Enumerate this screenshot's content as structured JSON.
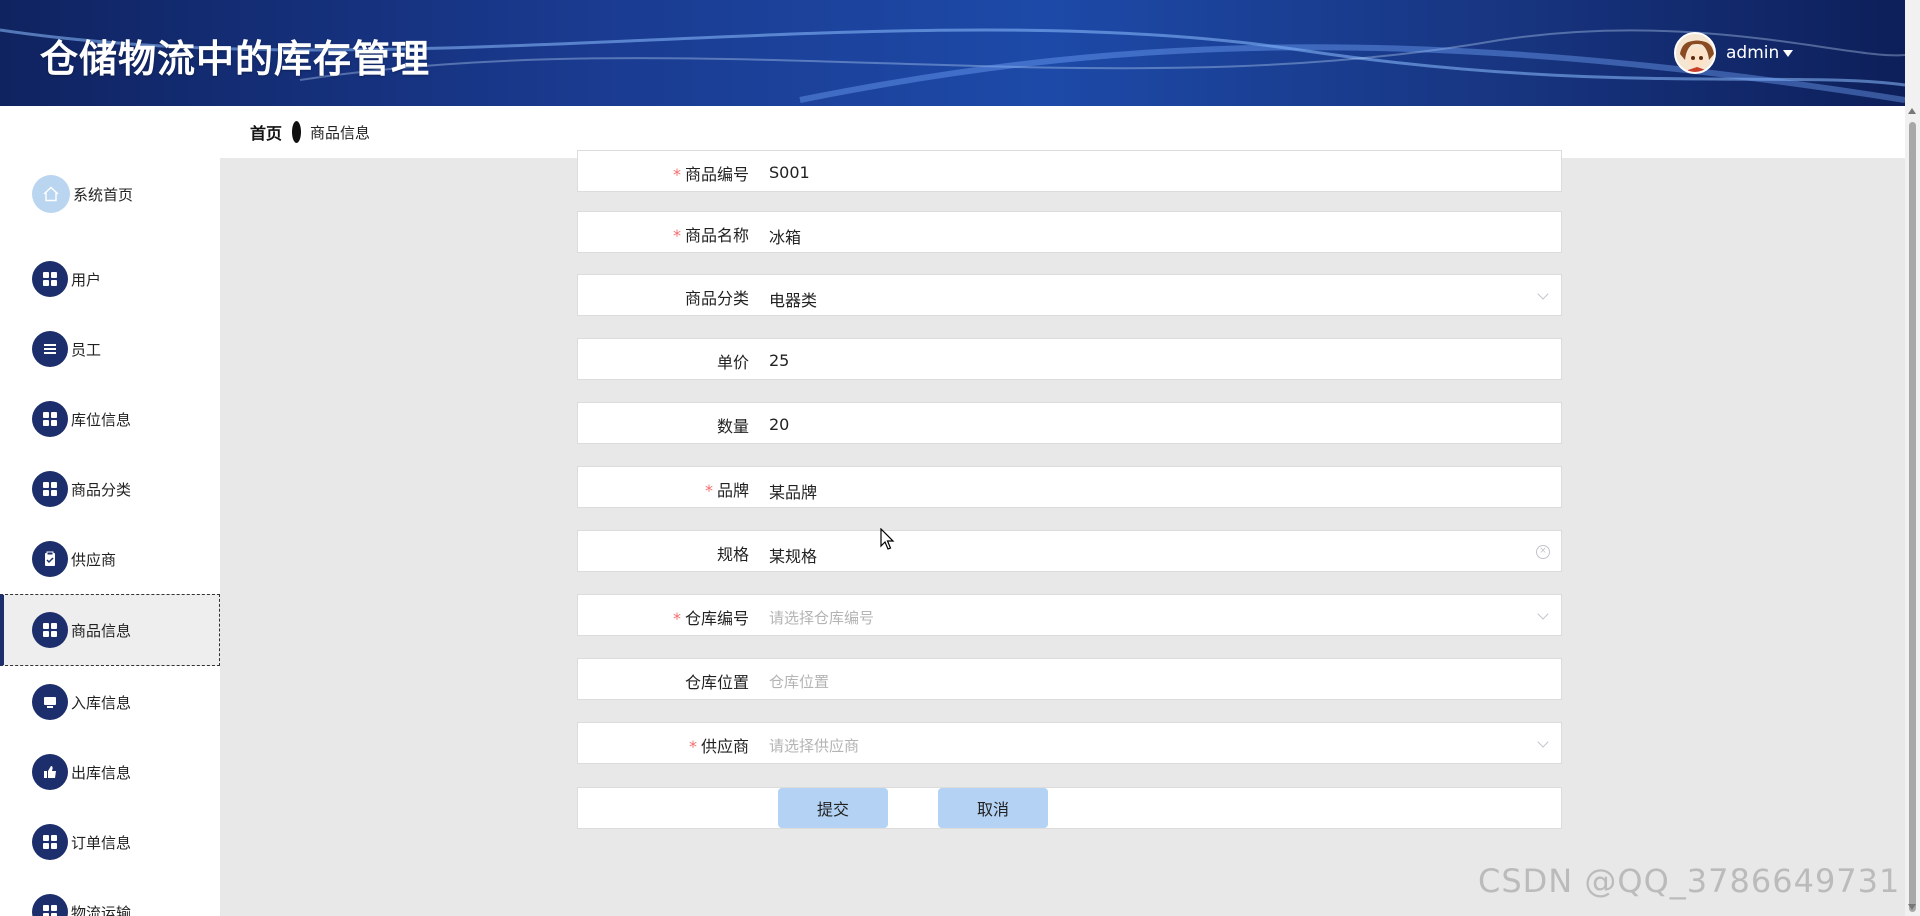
{
  "app": {
    "title": "仓储物流中的库存管理",
    "user": "admin"
  },
  "sidebar": {
    "items": [
      {
        "label": "系统首页",
        "icon": "home-icon"
      },
      {
        "label": "用户",
        "icon": "grid-icon"
      },
      {
        "label": "员工",
        "icon": "list-icon"
      },
      {
        "label": "库位信息",
        "icon": "grid-icon"
      },
      {
        "label": "商品分类",
        "icon": "grid-icon"
      },
      {
        "label": "供应商",
        "icon": "clipboard-icon"
      },
      {
        "label": "商品信息",
        "icon": "grid-icon",
        "active": true
      },
      {
        "label": "入库信息",
        "icon": "monitor-icon"
      },
      {
        "label": "出库信息",
        "icon": "thumb-icon"
      },
      {
        "label": "订单信息",
        "icon": "grid-icon"
      },
      {
        "label": "物流运输",
        "icon": "grid-icon"
      }
    ]
  },
  "breadcrumb": {
    "home": "首页",
    "current": "商品信息"
  },
  "form": {
    "fields": [
      {
        "label": "商品编号",
        "required": true,
        "value": "S001",
        "type": "input"
      },
      {
        "label": "商品名称",
        "required": true,
        "value": "冰箱",
        "type": "input"
      },
      {
        "label": "商品分类",
        "required": false,
        "value": "电器类",
        "type": "select"
      },
      {
        "label": "单价",
        "required": false,
        "value": "25",
        "type": "input"
      },
      {
        "label": "数量",
        "required": false,
        "value": "20",
        "type": "input"
      },
      {
        "label": "品牌",
        "required": true,
        "value": "某品牌",
        "type": "input"
      },
      {
        "label": "规格",
        "required": false,
        "value": "某规格",
        "type": "input-clearable"
      },
      {
        "label": "仓库编号",
        "required": true,
        "placeholder": "请选择仓库编号",
        "type": "select"
      },
      {
        "label": "仓库位置",
        "required": false,
        "placeholder": "仓库位置",
        "type": "input"
      },
      {
        "label": "供应商",
        "required": true,
        "placeholder": "请选择供应商",
        "type": "select"
      }
    ],
    "submit_label": "提交",
    "cancel_label": "取消"
  },
  "watermark": "CSDN @QQ_3786649731",
  "colors": {
    "header_bg": "#1a3a8f",
    "sidebar_icon_bg": "#1c2e6b",
    "button_bg": "#b3d2f4",
    "required_star": "#f56c6c",
    "main_bg": "#e8e8e8"
  }
}
